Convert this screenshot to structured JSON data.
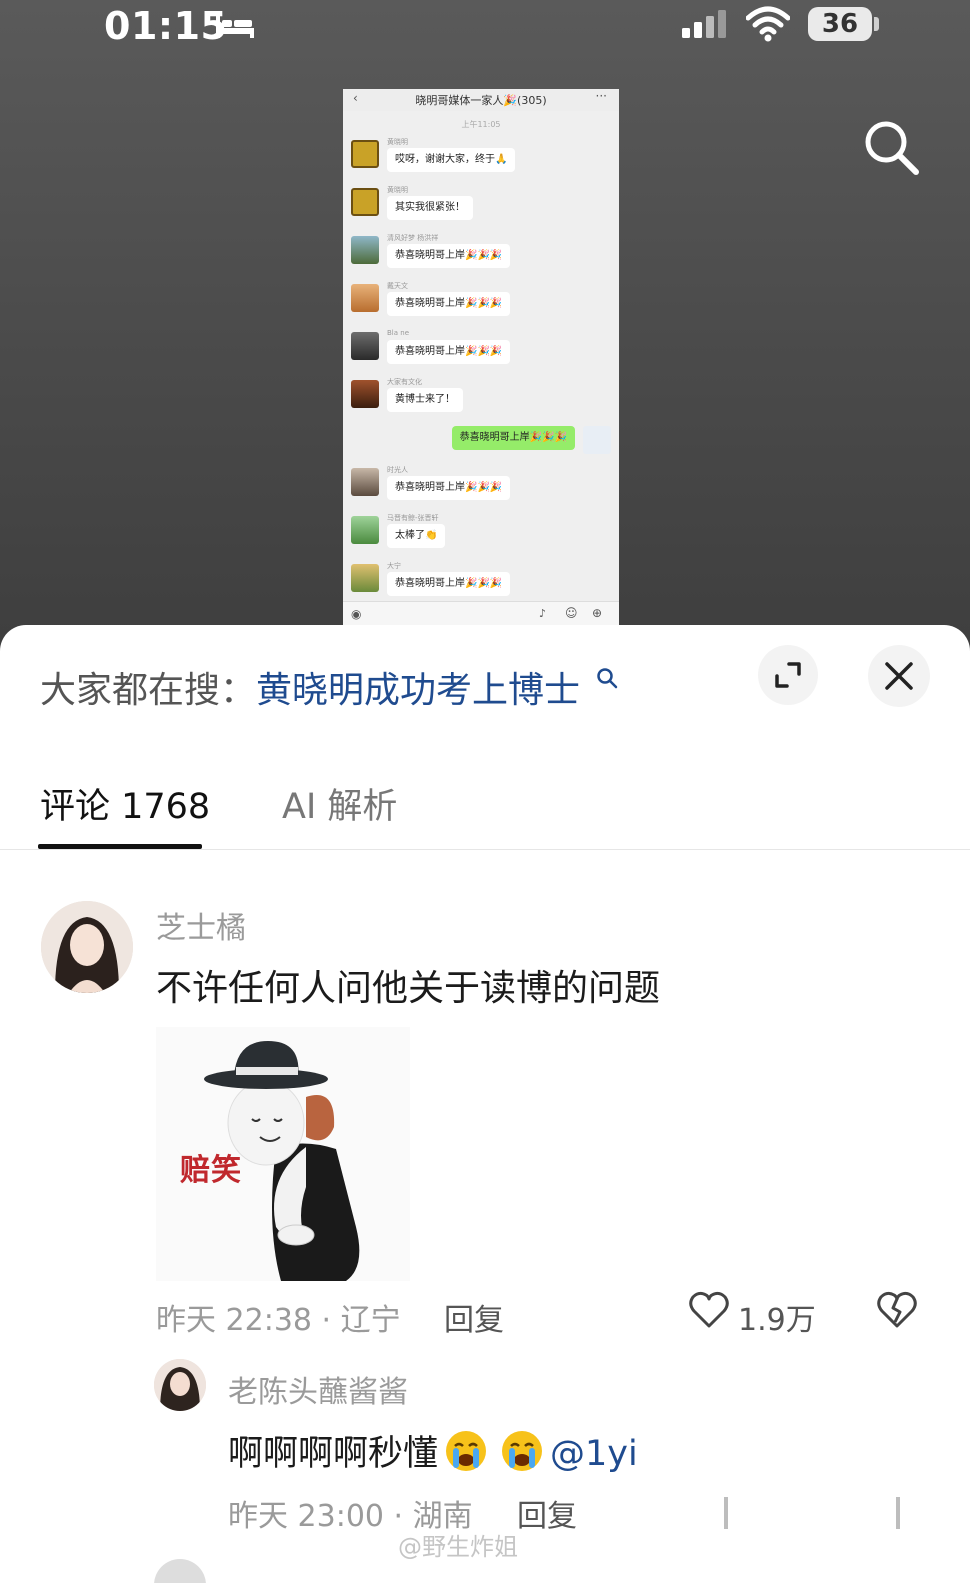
{
  "status_bar": {
    "time": "01:15",
    "battery": "36",
    "icons": [
      "bed-icon",
      "signal-icon",
      "wifi-icon",
      "battery-icon"
    ]
  },
  "embedded_chat": {
    "title": "晓明哥媒体一家人🎉(305)",
    "time": "上午11:05",
    "messages": [
      {
        "name": "黄晓明",
        "text": "哎呀，谢谢大家，终于🙏"
      },
      {
        "name": "黄晓明",
        "text": "其实我很紧张！"
      },
      {
        "name": "清风好梦 杨洪祥",
        "text": "恭喜晓明哥上岸🎉🎉🎉"
      },
      {
        "name": "戴天文",
        "text": "恭喜晓明哥上岸🎉🎉🎉"
      },
      {
        "name": "Bla ne",
        "text": "恭喜晓明哥上岸🎉🎉🎉"
      },
      {
        "name": "大家有文化",
        "text": "黄博士来了！"
      },
      {
        "name": "",
        "text": "恭喜晓明哥上岸🎉🎉🎉",
        "self": true
      },
      {
        "name": "时光人",
        "text": "恭喜晓明哥上岸🎉🎉🎉"
      },
      {
        "name": "马晋有鲸-张晋轩",
        "text": "太棒了👏"
      },
      {
        "name": "大宁",
        "text": "恭喜晓明哥上岸🎉🎉🎉"
      }
    ]
  },
  "sheet": {
    "hot_search_prefix": "大家都在搜：",
    "hot_search_link": "黄晓明成功考上博士",
    "tabs": [
      {
        "label": "评论 1768",
        "active": true
      },
      {
        "label": "AI 解析",
        "active": false
      }
    ]
  },
  "comment": {
    "username": "芝士橘",
    "text": "不许任何人问他关于读博的问题",
    "sticker_caption": "赔笑",
    "meta": "昨天 22:38 · 辽宁",
    "reply_label": "回复",
    "likes": "1.9万"
  },
  "reply": {
    "username": "老陈头蘸酱酱",
    "text": "啊啊啊啊秒懂",
    "mention": "@1yi",
    "meta": "昨天 23:00 · 湖南",
    "reply_label": "回复"
  },
  "watermark": "@野生炸姐",
  "colors": {
    "link": "#1f4b8f",
    "muted": "#9a9a9a",
    "chat_self_bubble": "#95ec69",
    "sticker_caption": "#c0282d"
  }
}
